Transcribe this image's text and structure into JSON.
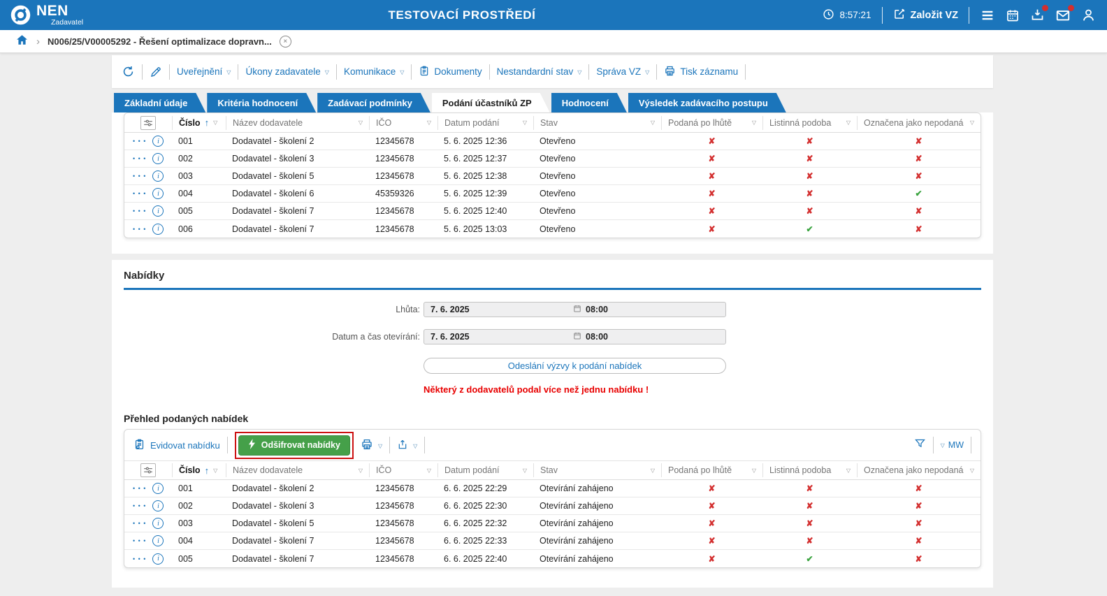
{
  "app": {
    "brand": "NEN",
    "brand_sub": "Zadavatel",
    "env_title": "TESTOVACÍ PROSTŘEDÍ",
    "time": "8:57:21",
    "create_vz_label": "Založit VZ"
  },
  "breadcrumb": {
    "item": "N006/25/V00005292 - Řešení optimalizace dopravn...",
    "close_glyph": "×"
  },
  "toolbar": {
    "items": [
      "Uveřejnění",
      "Úkony zadavatele",
      "Komunikace",
      "Dokumenty",
      "Nestandardní stav",
      "Správa VZ",
      "Tisk záznamu"
    ]
  },
  "tabs": [
    {
      "label": "Základní údaje"
    },
    {
      "label": "Kritéria hodnocení"
    },
    {
      "label": "Zadávací podmínky"
    },
    {
      "label": "Podání účastníků ZP"
    },
    {
      "label": "Hodnocení"
    },
    {
      "label": "Výsledek zadávacího postupu"
    }
  ],
  "columns": [
    "Číslo",
    "Název dodavatele",
    "IČO",
    "Datum podání",
    "Stav",
    "Podaná po lhůtě",
    "Listinná podoba",
    "Označena jako nepodaná"
  ],
  "participants_table": {
    "rows": [
      {
        "num": "001",
        "supplier": "Dodavatel - školení 2",
        "ico": "12345678",
        "submitted": "5. 6. 2025 12:36",
        "status": "Otevřeno",
        "late": false,
        "paper": false,
        "not_submitted": false
      },
      {
        "num": "002",
        "supplier": "Dodavatel - školení 3",
        "ico": "12345678",
        "submitted": "5. 6. 2025 12:37",
        "status": "Otevřeno",
        "late": false,
        "paper": false,
        "not_submitted": false
      },
      {
        "num": "003",
        "supplier": "Dodavatel - školení 5",
        "ico": "12345678",
        "submitted": "5. 6. 2025 12:38",
        "status": "Otevřeno",
        "late": false,
        "paper": false,
        "not_submitted": false
      },
      {
        "num": "004",
        "supplier": "Dodavatel - školení 6",
        "ico": "45359326",
        "submitted": "5. 6. 2025 12:39",
        "status": "Otevřeno",
        "late": false,
        "paper": false,
        "not_submitted": true
      },
      {
        "num": "005",
        "supplier": "Dodavatel - školení 7",
        "ico": "12345678",
        "submitted": "5. 6. 2025 12:40",
        "status": "Otevřeno",
        "late": false,
        "paper": false,
        "not_submitted": false
      },
      {
        "num": "006",
        "supplier": "Dodavatel - školení 7",
        "ico": "12345678",
        "submitted": "5. 6. 2025 13:03",
        "status": "Otevřeno",
        "late": false,
        "paper": true,
        "not_submitted": false
      }
    ]
  },
  "offers_section": {
    "title": "Nabídky",
    "deadline_label": "Lhůta:",
    "deadline_date": "7. 6. 2025",
    "deadline_time": "08:00",
    "opening_label": "Datum a čas otevírání:",
    "opening_date": "7. 6. 2025",
    "opening_time": "08:00",
    "send_invite_button": "Odeslání výzvy k podání nabídek",
    "warning": "Některý z dodavatelů podal více než jednu nabídku !",
    "overview_title": "Přehled podaných nabídek",
    "register_offer_button": "Evidovat nabídku",
    "decrypt_offers_button": "Odšifrovat nabídky",
    "mw_label": "MW"
  },
  "offers_table": {
    "rows": [
      {
        "num": "001",
        "supplier": "Dodavatel - školení 2",
        "ico": "12345678",
        "submitted": "6. 6. 2025 22:29",
        "status": "Otevírání zahájeno",
        "late": false,
        "paper": false,
        "not_submitted": false
      },
      {
        "num": "002",
        "supplier": "Dodavatel - školení 3",
        "ico": "12345678",
        "submitted": "6. 6. 2025 22:30",
        "status": "Otevírání zahájeno",
        "late": false,
        "paper": false,
        "not_submitted": false
      },
      {
        "num": "003",
        "supplier": "Dodavatel - školení 5",
        "ico": "12345678",
        "submitted": "6. 6. 2025 22:32",
        "status": "Otevírání zahájeno",
        "late": false,
        "paper": false,
        "not_submitted": false
      },
      {
        "num": "004",
        "supplier": "Dodavatel - školení 7",
        "ico": "12345678",
        "submitted": "6. 6. 2025 22:33",
        "status": "Otevírání zahájeno",
        "late": false,
        "paper": false,
        "not_submitted": false
      },
      {
        "num": "005",
        "supplier": "Dodavatel - školení 7",
        "ico": "12345678",
        "submitted": "6. 6. 2025 22:40",
        "status": "Otevírání zahájeno",
        "late": false,
        "paper": true,
        "not_submitted": false
      }
    ]
  }
}
